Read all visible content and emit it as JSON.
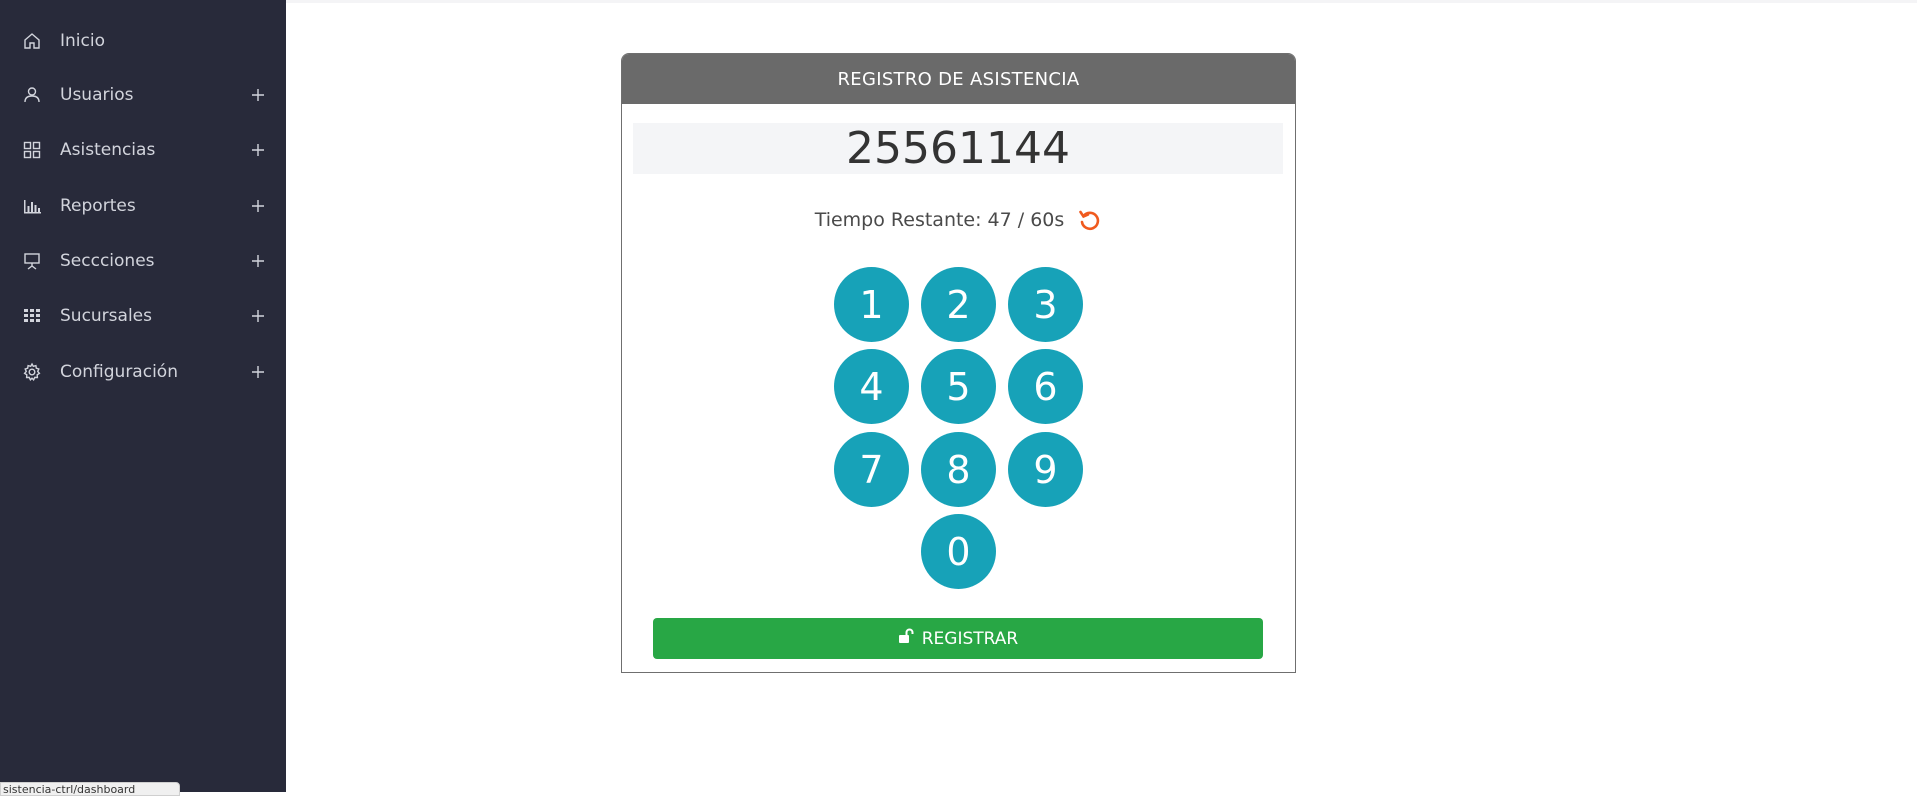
{
  "sidebar": {
    "items": [
      {
        "label": "Inicio",
        "icon": "home-icon",
        "expandable": false
      },
      {
        "label": "Usuarios",
        "icon": "user-icon",
        "expandable": true
      },
      {
        "label": "Asistencias",
        "icon": "grid-icon",
        "expandable": true
      },
      {
        "label": "Reportes",
        "icon": "bar-chart-icon",
        "expandable": true
      },
      {
        "label": "Seccciones",
        "icon": "presentation-icon",
        "expandable": true
      },
      {
        "label": "Sucursales",
        "icon": "table-grid-icon",
        "expandable": true
      },
      {
        "label": "Configuración",
        "icon": "gear-icon",
        "expandable": true
      }
    ]
  },
  "status_url": "sistencia-ctrl/dashboard",
  "card": {
    "title": "REGISTRO DE ASISTENCIA",
    "display_value": "25561144",
    "timer_label": "Tiempo Restante: 47 / 60s",
    "keys": [
      "1",
      "2",
      "3",
      "4",
      "5",
      "6",
      "7",
      "8",
      "9",
      "0"
    ],
    "register_label": "REGISTRAR"
  },
  "colors": {
    "sidebar_bg": "#282a3a",
    "header_bg": "#6a6a6a",
    "key_bg": "#17a2b8",
    "register_bg": "#28a745",
    "reload_icon": "#f05a1e"
  }
}
